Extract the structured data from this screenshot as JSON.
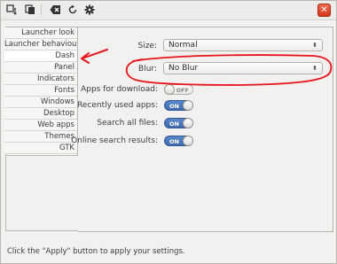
{
  "toolbar": {
    "icons": [
      "overview-icon",
      "copy-icon",
      "backspace-icon",
      "refresh-icon",
      "settings-gear-icon"
    ],
    "close_glyph": "✕"
  },
  "sidebar": {
    "items": [
      {
        "label": "Launcher look"
      },
      {
        "label": "Launcher behaviour"
      },
      {
        "label": "Dash"
      },
      {
        "label": "Panel"
      },
      {
        "label": "Indicators"
      },
      {
        "label": "Fonts"
      },
      {
        "label": "Windows"
      },
      {
        "label": "Desktop"
      },
      {
        "label": "Web apps"
      },
      {
        "label": "Themes"
      },
      {
        "label": "GTK"
      }
    ],
    "active": "Dash"
  },
  "settings": {
    "size": {
      "label": "Size:",
      "value": "Normal"
    },
    "blur": {
      "label": "Blur:",
      "value": "No Blur"
    },
    "apps_for_download": {
      "label": "Apps for download:",
      "state": "OFF"
    },
    "recently_used_apps": {
      "label": "Recently used apps:",
      "state": "ON"
    },
    "search_all_files": {
      "label": "Search all files:",
      "state": "ON"
    },
    "online_search_results": {
      "label": "Online search results:",
      "state": "ON"
    }
  },
  "status": {
    "message": "Click the \"Apply\" button to apply your settings."
  },
  "colors": {
    "annotation": "#e8141c",
    "toggle_on": "#4a74b9",
    "close_button": "#e2502f"
  }
}
